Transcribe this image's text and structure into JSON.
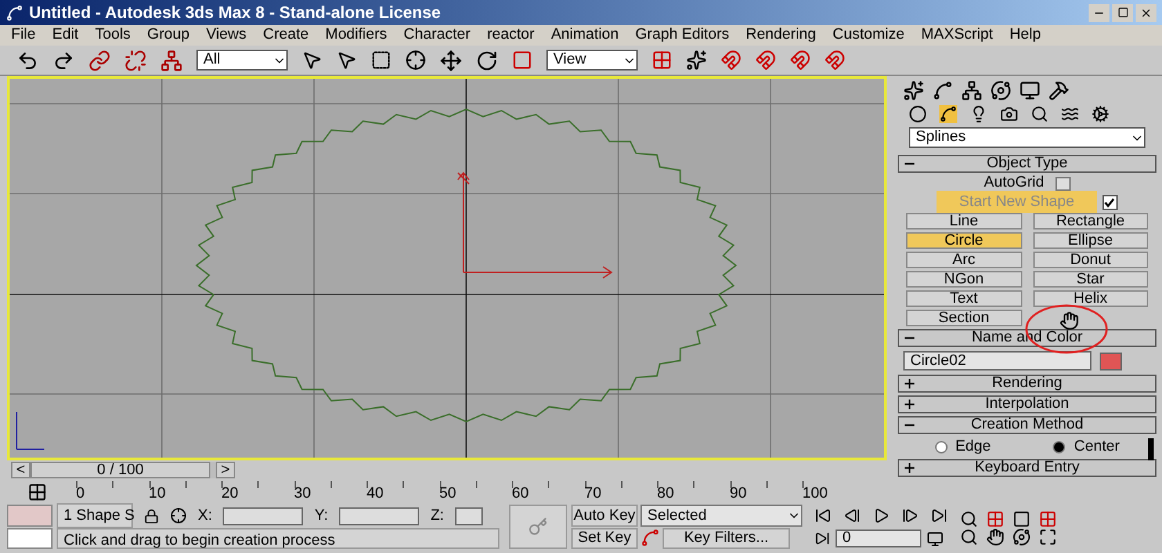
{
  "window": {
    "title": "Untitled - Autodesk 3ds Max 8  - Stand-alone License"
  },
  "menu": [
    "File",
    "Edit",
    "Tools",
    "Group",
    "Views",
    "Create",
    "Modifiers",
    "Character",
    "reactor",
    "Animation",
    "Graph Editors",
    "Rendering",
    "Customize",
    "MAXScript",
    "Help"
  ],
  "toolbar": {
    "selection_filter": "All",
    "reference_coordinate": "View"
  },
  "command_panel": {
    "category": "Splines",
    "object_type": {
      "title": "Object Type",
      "expanded": true,
      "autogrid": {
        "label": "AutoGrid",
        "checked": false
      },
      "start_new_shape": {
        "label": "Start New Shape",
        "checked": true
      },
      "buttons": [
        {
          "label": "Line",
          "selected": false
        },
        {
          "label": "Rectangle",
          "selected": false
        },
        {
          "label": "Circle",
          "selected": true
        },
        {
          "label": "Ellipse",
          "selected": false
        },
        {
          "label": "Arc",
          "selected": false
        },
        {
          "label": "Donut",
          "selected": false
        },
        {
          "label": "NGon",
          "selected": false
        },
        {
          "label": "Star",
          "selected": false
        },
        {
          "label": "Text",
          "selected": false
        },
        {
          "label": "Helix",
          "selected": false
        },
        {
          "label": "Section",
          "selected": false
        }
      ]
    },
    "name_and_color": {
      "title": "Name and Color",
      "expanded": true,
      "name": "Circle02",
      "color": "#e05555"
    },
    "rollouts": [
      {
        "title": "Rendering",
        "expanded": false
      },
      {
        "title": "Interpolation",
        "expanded": false
      }
    ],
    "creation_method": {
      "title": "Creation Method",
      "expanded": true,
      "options": [
        {
          "label": "Edge",
          "selected": false
        },
        {
          "label": "Center",
          "selected": true
        }
      ]
    },
    "keyboard_entry": {
      "title": "Keyboard Entry",
      "expanded": false
    }
  },
  "time_slider": {
    "prev": "<",
    "frame": "0 / 100",
    "next": ">",
    "level": 0
  },
  "track_bar": {
    "labels": [
      "0",
      "10",
      "20",
      "30",
      "40",
      "50",
      "60",
      "70",
      "80",
      "90",
      "100"
    ]
  },
  "status": {
    "selection": "1 Shape S",
    "x_label": "X:",
    "y_label": "Y:",
    "z_label": "Z:",
    "prompt": "Click and drag to begin creation process",
    "auto_key": "Auto Key",
    "set_key": "Set Key",
    "key_mode": "Selected",
    "key_filters": "Key Filters...",
    "current_frame": "0"
  }
}
